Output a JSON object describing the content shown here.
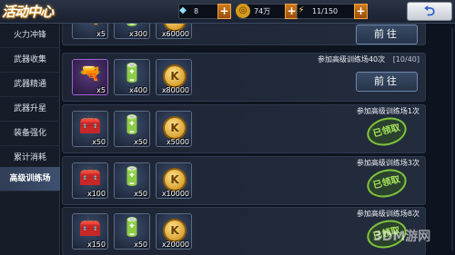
{
  "header": {
    "title": "活动中心",
    "diamonds": "8",
    "gold": "74万",
    "stamina": "11/150",
    "plus": "+",
    "back_icon": "return-arrow-icon"
  },
  "sidebar": {
    "items": [
      {
        "label": "火力冲锋"
      },
      {
        "label": "武器收集"
      },
      {
        "label": "武器精通"
      },
      {
        "label": "武器升星"
      },
      {
        "label": "装备强化"
      },
      {
        "label": "累计消耗"
      },
      {
        "label": "高级训练场"
      }
    ]
  },
  "rows": [
    {
      "desc": "",
      "progress": "",
      "button": "前往",
      "rewards": [
        "x5",
        "x300",
        "x60000"
      ]
    },
    {
      "desc": "参加高级训练场40次",
      "progress": "[10/40]",
      "button": "前往",
      "rewards": [
        "x5",
        "x400",
        "x80000"
      ]
    },
    {
      "desc": "参加高级训练场1次",
      "stamp": "已领取",
      "rewards": [
        "x50",
        "x50",
        "x5000"
      ]
    },
    {
      "desc": "参加高级训练场3次",
      "stamp": "已领取",
      "rewards": [
        "x100",
        "x50",
        "x10000"
      ]
    },
    {
      "desc": "参加高级训练场8次",
      "stamp": "已领取",
      "rewards": [
        "x150",
        "x50",
        "x20000"
      ]
    }
  ],
  "watermark": "3DM游网",
  "colors": {
    "accent": "#d07a1c",
    "claimed": "#7fc43a",
    "active_tab": "#3f5170"
  }
}
